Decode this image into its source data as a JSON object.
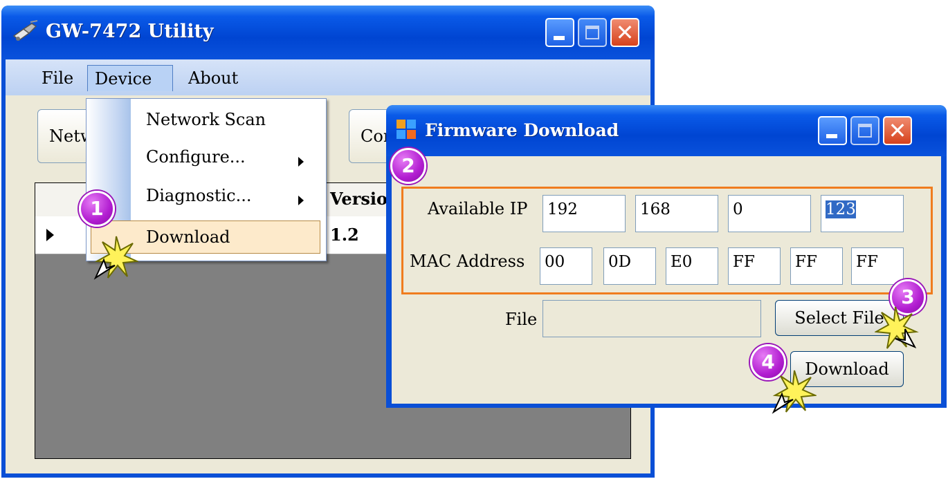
{
  "main_window": {
    "title": "GW-7472 Utility",
    "menu": [
      "File",
      "Device",
      "About"
    ],
    "toolbar": [
      "Network Scan",
      "Configure"
    ],
    "grid": {
      "header_visible": "Version",
      "row_value": "1.2"
    }
  },
  "device_menu": {
    "items": [
      {
        "label": "Network Scan",
        "submenu": false
      },
      {
        "label": "Configure...",
        "submenu": true
      },
      {
        "label": "Diagnostic...",
        "submenu": true
      },
      {
        "label": "Download",
        "submenu": false,
        "highlighted": true
      }
    ]
  },
  "firmware_dialog": {
    "title": "Firmware Download",
    "available_ip_label": "Available IP",
    "ip_octets": [
      "192",
      "168",
      "0",
      "123"
    ],
    "ip_selected_index": 3,
    "mac_label": "MAC Address",
    "mac_bytes": [
      "00",
      "0D",
      "E0",
      "FF",
      "FF",
      "FF"
    ],
    "file_label": "File",
    "file_value": "",
    "select_file_button": "Select File",
    "download_button": "Download"
  },
  "steps": [
    "1",
    "2",
    "3",
    "4"
  ],
  "colors": {
    "titlebar_blue": "#0a4fd6",
    "window_face": "#ece9d8",
    "highlight_frame": "#f07c1e",
    "step_badge": "#b21ed1",
    "menu_highlight": "#fdeacb"
  },
  "icons": [
    "app-icon",
    "minimize-icon",
    "maximize-icon",
    "close-icon",
    "submenu-arrow-icon",
    "row-pointer-icon",
    "dialog-icon",
    "click-cursor-icon"
  ]
}
